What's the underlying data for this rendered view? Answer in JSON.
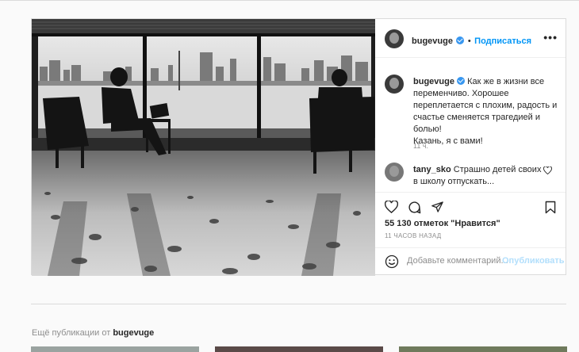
{
  "post": {
    "username": "bugevuge",
    "follow_label": "Подписаться",
    "more_icon": "more-horizontal-icon",
    "caption": "Как же в жизни все переменчиво. Хорошее переплетается с плохим, радость и счастье сменяется трагедией и болью!\nКазань, я с вами!",
    "caption_time": "11 ч.",
    "comment_user": "tany_sko",
    "comment_text": "Страшно детей своих в школу отпускать...",
    "likes": "55 130 отметок \"Нравится\"",
    "time_ago": "11 ЧАСОВ НАЗАД",
    "comment_placeholder": "Добавьте комментарий...",
    "publish_label": "Опубликовать"
  },
  "more_posts": {
    "prefix": "Ещё публикации от",
    "username": "bugevuge"
  },
  "colors": {
    "accent": "#0095f6",
    "verified": "#3897f0",
    "publish_disabled": "#b2dffc"
  }
}
